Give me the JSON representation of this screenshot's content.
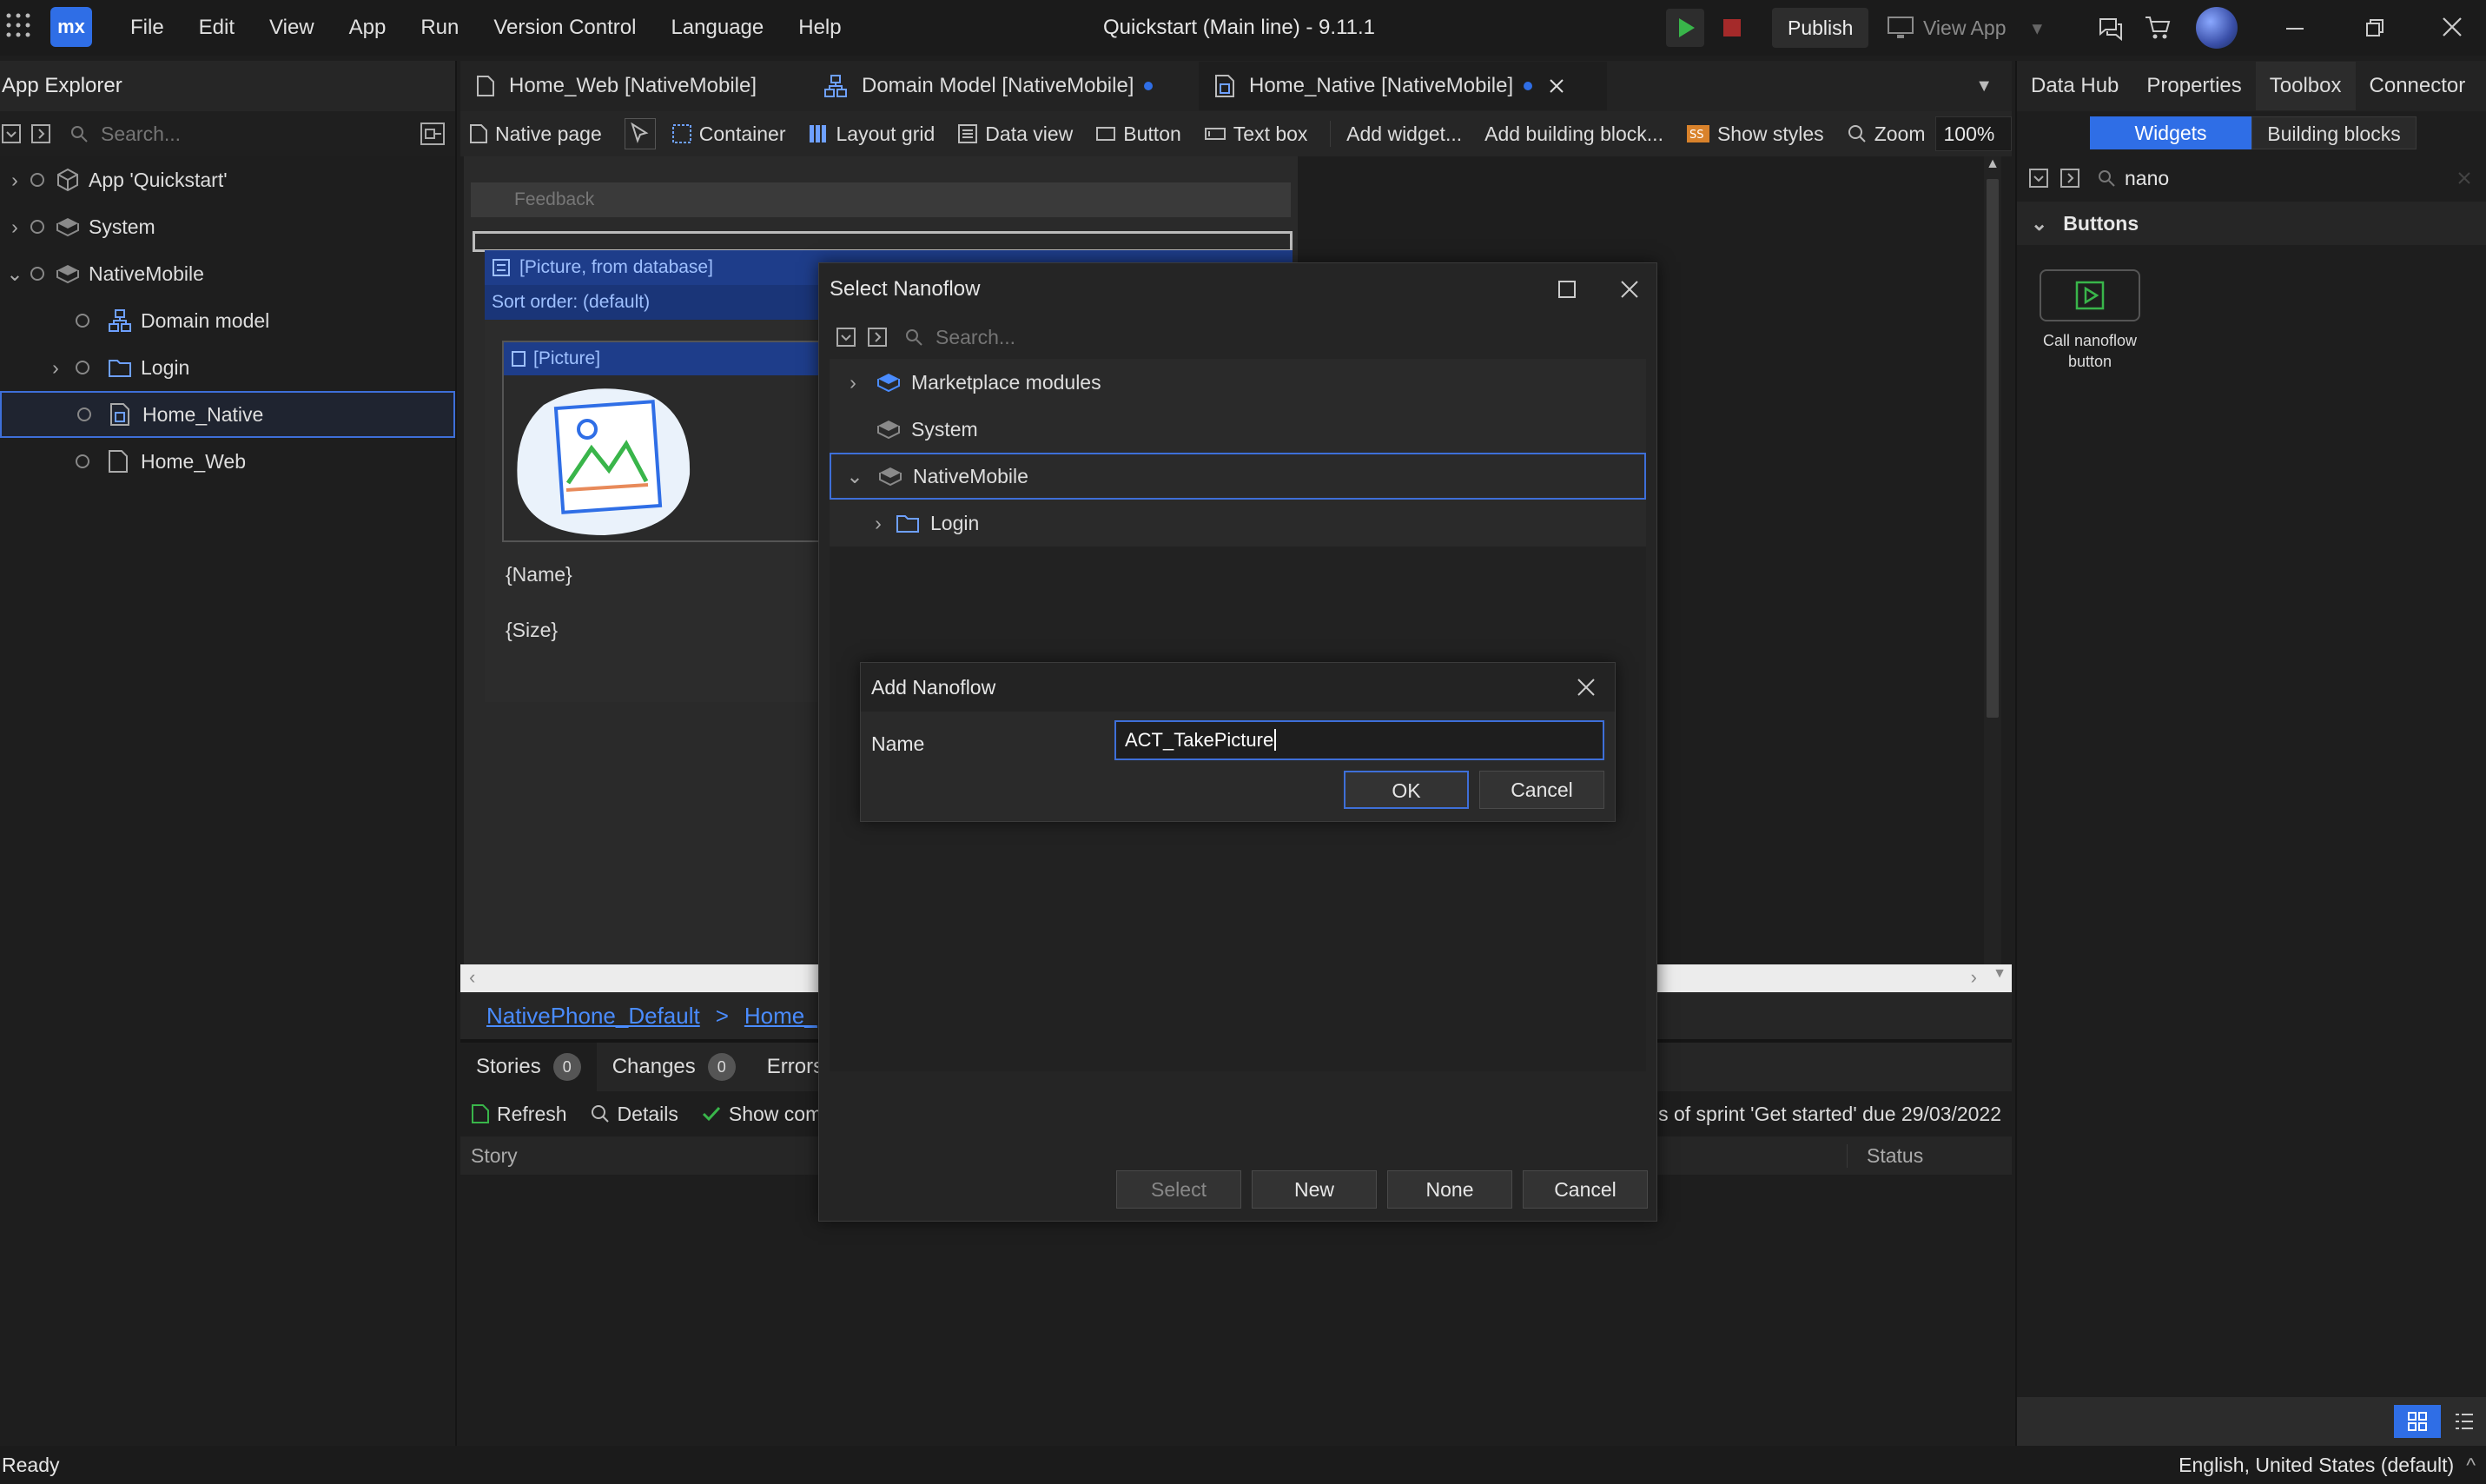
{
  "title_bar": {
    "logo": "mx",
    "menu": [
      "File",
      "Edit",
      "View",
      "App",
      "Run",
      "Version Control",
      "Language",
      "Help"
    ],
    "title": "Quickstart (Main line)  -  9.11.1",
    "publish_label": "Publish",
    "view_app_label": "View App"
  },
  "app_explorer": {
    "title": "App Explorer",
    "search_placeholder": "Search...",
    "tree": [
      {
        "label": "App 'Quickstart'",
        "icon": "app-icon"
      },
      {
        "label": "System",
        "icon": "module-icon"
      },
      {
        "label": "NativeMobile",
        "icon": "module-icon"
      },
      {
        "label": "Domain model",
        "icon": "domain-model-icon"
      },
      {
        "label": "Login",
        "icon": "folder-icon"
      },
      {
        "label": "Home_Native",
        "icon": "page-icon"
      },
      {
        "label": "Home_Web",
        "icon": "page-icon"
      }
    ]
  },
  "doc_tabs": [
    {
      "label": "Home_Web [NativeMobile]"
    },
    {
      "label": "Domain Model [NativeMobile]"
    },
    {
      "label": "Home_Native [NativeMobile]"
    }
  ],
  "editor_toolbar": {
    "items": [
      "Native page",
      "Container",
      "Layout grid",
      "Data view",
      "Button",
      "Text box",
      "Add widget...",
      "Add building block...",
      "Show styles",
      "Zoom"
    ],
    "zoom_value": "100%"
  },
  "canvas": {
    "feedback": "Feedback",
    "list_view_label": "[Picture, from database]",
    "sort_order": "Sort order: (default)",
    "picture_label": "[Picture]",
    "name_field": "{Name}",
    "size_field": "{Size}"
  },
  "breadcrumb": {
    "layout": "NativePhone_Default",
    "sep": ">",
    "page": "Home_"
  },
  "bottom_panel": {
    "tabs": [
      {
        "label": "Stories",
        "count": "0"
      },
      {
        "label": "Changes",
        "count": "0"
      },
      {
        "label": "Errors",
        "count": ""
      }
    ],
    "refresh": "Refresh",
    "details": "Details",
    "show_comp": "Show comp",
    "sprint_text": "s of sprint 'Get started' due 29/03/2022",
    "col_story": "Story",
    "col_status": "Status"
  },
  "right_panel": {
    "tabs": [
      "Data Hub",
      "Properties",
      "Toolbox",
      "Connector"
    ],
    "subtabs": [
      "Widgets",
      "Building blocks"
    ],
    "search_value": "nano",
    "section": "Buttons",
    "widget_label": "Call nanoflow button"
  },
  "select_nanoflow": {
    "title": "Select Nanoflow",
    "search_placeholder": "Search...",
    "tree": [
      {
        "label": "Marketplace modules"
      },
      {
        "label": "System"
      },
      {
        "label": "NativeMobile"
      },
      {
        "label": "Login"
      }
    ],
    "buttons": [
      "Select",
      "New",
      "None",
      "Cancel"
    ]
  },
  "add_nanoflow": {
    "title": "Add Nanoflow",
    "name_label": "Name",
    "name_value": "ACT_TakePicture",
    "ok": "OK",
    "cancel": "Cancel"
  },
  "status_bar": {
    "left": "Ready",
    "right": "English, United States (default)"
  },
  "colors": {
    "accent": "#2f6ee6",
    "selection_border": "#3e6fd8",
    "play_green": "#39b54a",
    "stop_red": "#a52a2a"
  }
}
